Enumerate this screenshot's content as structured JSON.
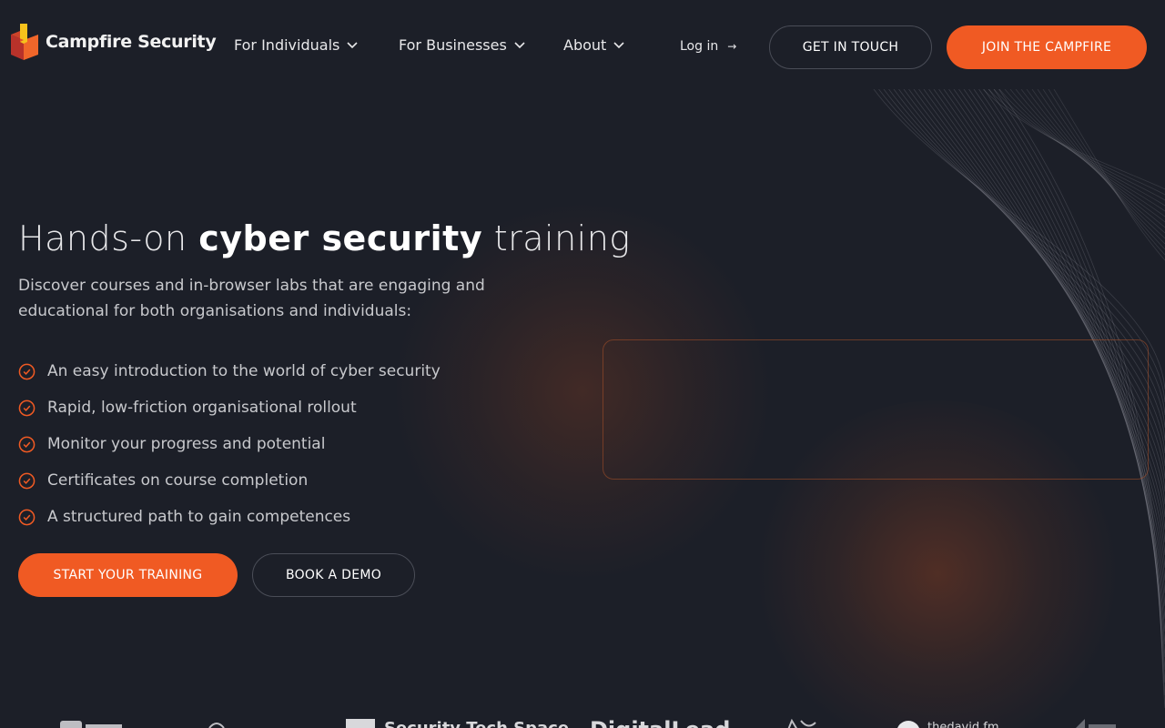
{
  "brand": {
    "name": "Campfire Security",
    "accent": "#f05a23",
    "background": "#1c1f28"
  },
  "nav": {
    "items": [
      {
        "label": "For Individuals",
        "icon": "chevron-down-icon"
      },
      {
        "label": "For Businesses",
        "icon": "chevron-down-icon"
      },
      {
        "label": "About",
        "icon": "chevron-down-icon"
      }
    ],
    "login_label": "Log in",
    "login_arrow": "→",
    "get_in_touch": "GET IN TOUCH",
    "join": "JOIN THE CAMPFIRE"
  },
  "hero": {
    "title_pre": "Hands-on ",
    "title_strong": "cyber security",
    "title_post": " training",
    "subtitle": "Discover courses and in-browser labs that are engaging and educational for both organisations and individuals:",
    "features": [
      "An easy introduction to the world of cyber security",
      "Rapid, low-friction organisational rollout",
      "Monitor your progress and potential",
      "Certificates on course completion",
      "A structured path to gain competences"
    ],
    "feature_icon": "check-circle-icon",
    "primary_cta": "START YOUR TRAINING",
    "secondary_cta": "BOOK A DEMO"
  },
  "partners": [
    "Security Tech Space",
    "DigitalLead",
    "thedavid fm"
  ]
}
